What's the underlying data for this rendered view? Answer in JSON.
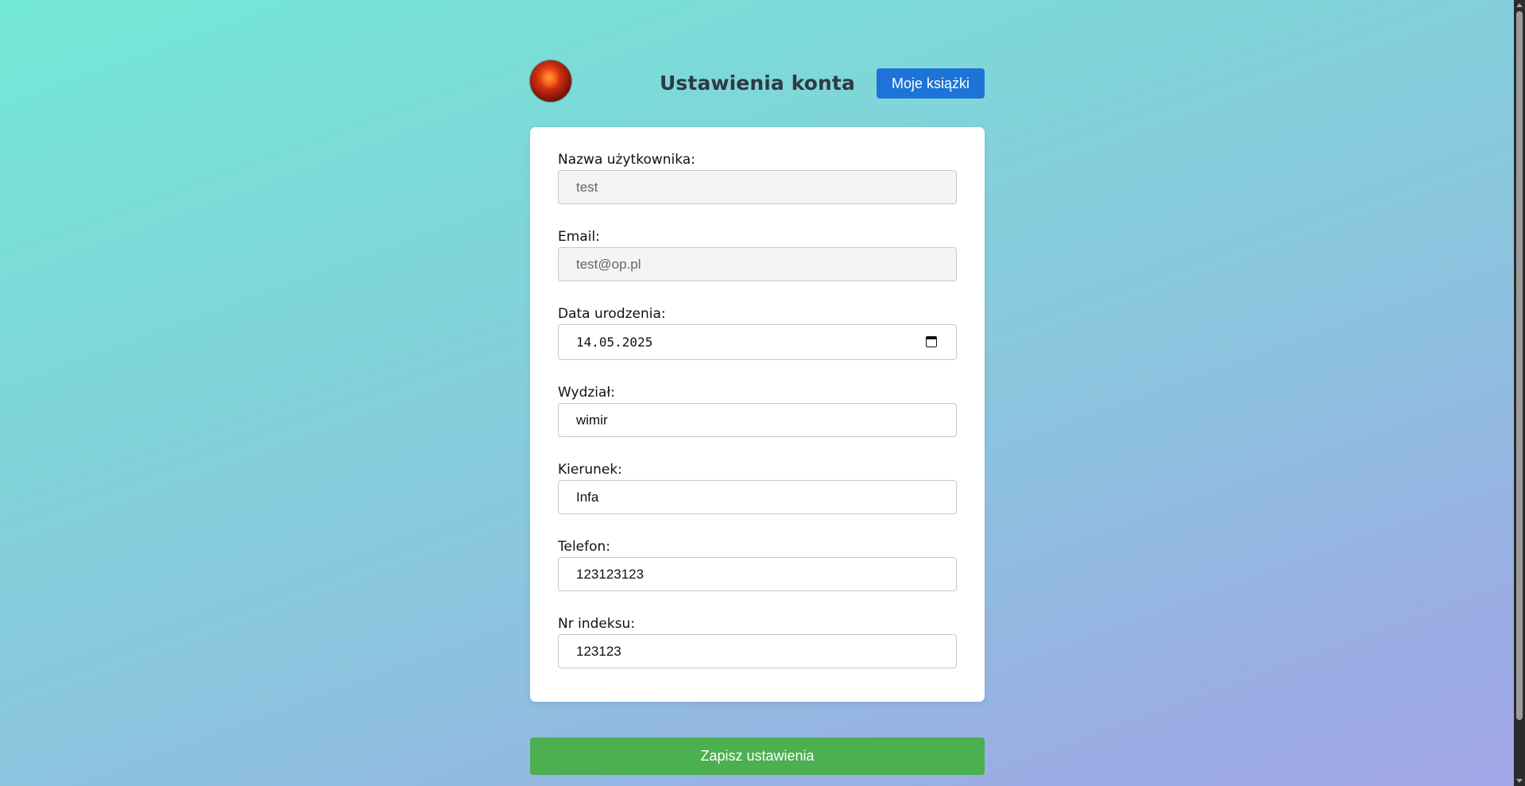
{
  "header": {
    "title": "Ustawienia konta",
    "books_button_label": "Moje książki"
  },
  "form": {
    "username": {
      "label": "Nazwa użytkownika:",
      "value": "test",
      "readonly": true
    },
    "email": {
      "label": "Email:",
      "value": "test@op.pl",
      "readonly": true
    },
    "birth_date": {
      "label": "Data urodzenia:",
      "value": "14.05.2025"
    },
    "faculty": {
      "label": "Wydział:",
      "value": "wimir"
    },
    "major": {
      "label": "Kierunek:",
      "value": "Infa"
    },
    "phone": {
      "label": "Telefon:",
      "value": "123123123"
    },
    "index_number": {
      "label": "Nr indeksu:",
      "value": "123123"
    }
  },
  "save_button_label": "Zapisz ustawienia",
  "icons": {
    "avatar": "avatar-image",
    "date_picker": "calendar-icon"
  },
  "colors": {
    "primary_button": "#1e74d6",
    "save_button": "#4caf50",
    "gradient_start": "#73e8d6",
    "gradient_end": "#a2a6e6"
  }
}
